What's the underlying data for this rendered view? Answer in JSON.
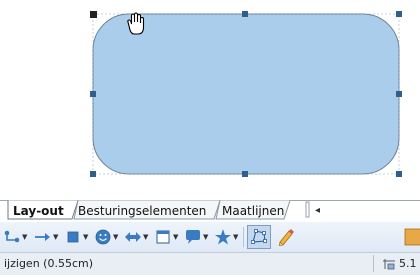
{
  "tabs": [
    {
      "label": "Lay-out",
      "active": true
    },
    {
      "label": "Besturingselementen",
      "active": false
    },
    {
      "label": "Maatlijnen",
      "active": false
    }
  ],
  "tab_scroll_left_glyph": "◂",
  "status": {
    "left_text": "ijzigen (0.55cm)",
    "position_text": "5.1"
  },
  "shape": {
    "type": "rounded-rectangle",
    "fill": "#a9cdeb",
    "stroke": "#6b7f94",
    "selected": true
  },
  "cursor": "hand-grab-icon",
  "toolbar_icons": [
    "connector-icon",
    "arrow-right-icon",
    "rectangle-icon",
    "smiley-icon",
    "double-arrow-icon",
    "flowchart-icon",
    "callout-icon",
    "star-icon",
    "points-edit-icon",
    "pencil-icon"
  ],
  "colors": {
    "toolbar_bg": "#e4ecf6",
    "accent_blue": "#3a7cc4",
    "statusbar_bg": "#e9eef4"
  }
}
